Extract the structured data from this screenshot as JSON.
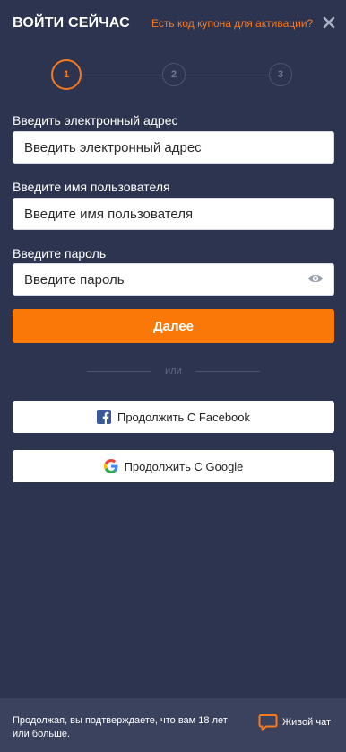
{
  "header": {
    "title": "ВОЙТИ СЕЙЧАС",
    "coupon_link": "Есть код купона для активации?",
    "close_icon": "close-icon"
  },
  "stepper": {
    "steps": [
      "1",
      "2",
      "3"
    ],
    "active_step": 1
  },
  "form": {
    "email": {
      "label": "Введить электронный адрес",
      "placeholder": "Введить электронный адрес",
      "value": ""
    },
    "username": {
      "label": "Введите имя пользователя",
      "placeholder": "Введите имя пользователя",
      "value": ""
    },
    "password": {
      "label": "Введите пароль",
      "placeholder": "Введите пароль",
      "value": "",
      "toggle_icon": "eye-icon"
    },
    "next_label": "Далее"
  },
  "divider": {
    "text": "или"
  },
  "social": {
    "facebook_label": "Продолжить С Facebook",
    "google_label": "Продолжить С Google"
  },
  "footer": {
    "disclaimer": "Продолжая, вы подтверждаете, что вам 18 лет или больше.",
    "live_chat_label": "Живой чат",
    "live_chat_icon": "chat-bubble-icon"
  },
  "colors": {
    "background": "#2d3450",
    "accent": "#f97807",
    "footer_background": "#3a425e"
  }
}
